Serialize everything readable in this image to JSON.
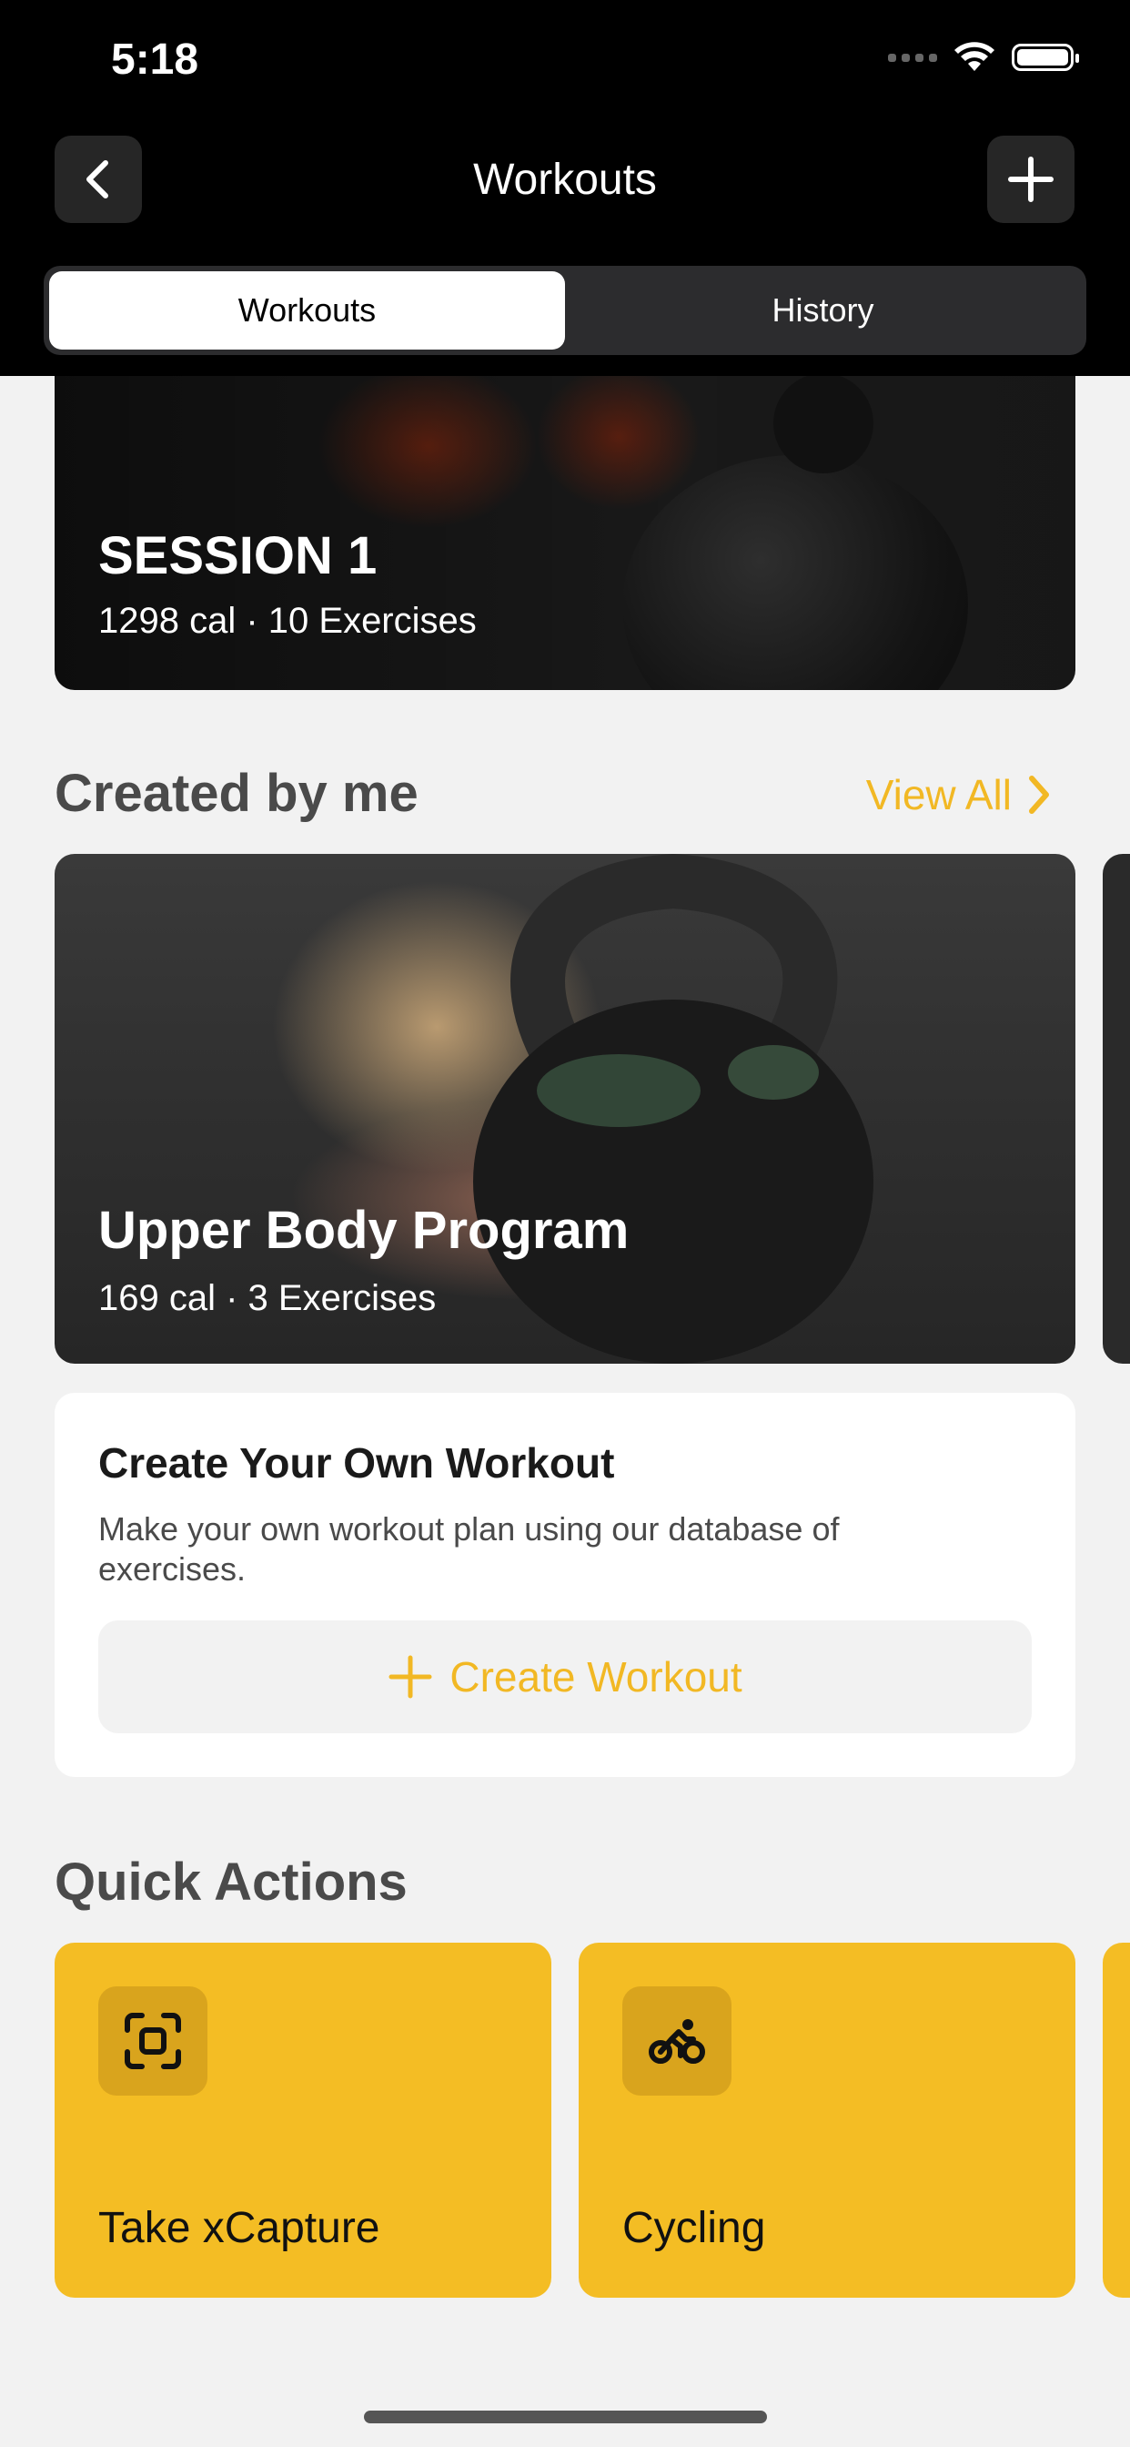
{
  "status_bar": {
    "time": "5:18"
  },
  "nav": {
    "title": "Workouts"
  },
  "segments": [
    {
      "label": "Workouts",
      "active": true
    },
    {
      "label": "History",
      "active": false
    }
  ],
  "session_card": {
    "title": "SESSION 1",
    "meta": "1298 cal · 10 Exercises"
  },
  "created": {
    "section_title": "Created by me",
    "view_all": "View All",
    "card": {
      "title": "Upper Body Program",
      "meta": "169 cal · 3 Exercises"
    }
  },
  "create_own": {
    "title": "Create Your Own Workout",
    "description": "Make your own workout plan using our database of exercises.",
    "button_label": "Create Workout"
  },
  "quick_actions": {
    "section_title": "Quick Actions",
    "items": [
      {
        "label": "Take xCapture",
        "icon": "scan-icon"
      },
      {
        "label": "Cycling",
        "icon": "bicycle-icon"
      }
    ]
  },
  "colors": {
    "accent": "#f2b824",
    "quick_action_bg": "#f4bd24",
    "topbar": "#000000"
  }
}
